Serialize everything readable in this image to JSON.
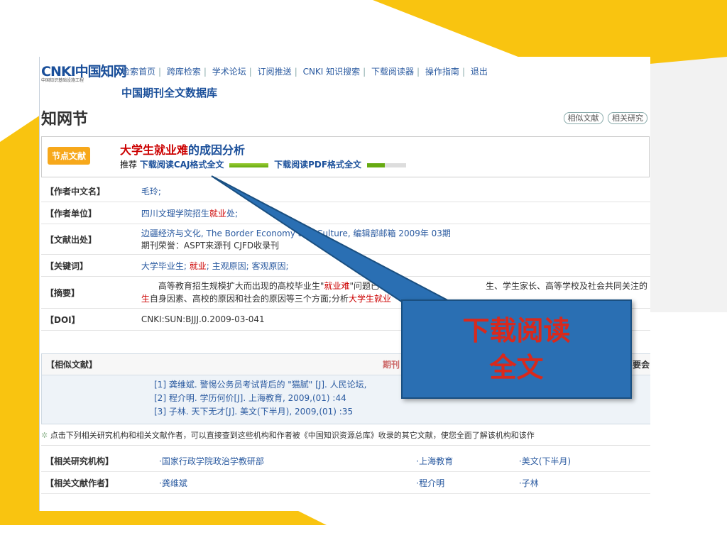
{
  "nav": {
    "logo": "CNKI中国知网",
    "logo_sub": "中国知识基础设施工程",
    "items": [
      "检索首页",
      "跨库检索",
      "学术论坛",
      "订阅推送",
      "CNKI 知识搜索",
      "下载阅读器",
      "操作指南",
      "退出"
    ]
  },
  "db_title": "中国期刊全文数据库",
  "zhijie": "知网节",
  "sim_buttons": [
    "相似文献",
    "相关研究"
  ],
  "article": {
    "badge": "节点文献",
    "title_a": "大学生",
    "title_b": "就业难",
    "title_c": "的成因分析",
    "recommend": "推荐",
    "caj": "下载阅读CAJ格式全文",
    "pdf": "下载阅读PDF格式全文"
  },
  "meta": {
    "author_label": "【作者中文名】",
    "author": "毛玲;",
    "unit_label": "【作者单位】",
    "unit_a": "四川文理学院招生",
    "unit_b": "就业",
    "unit_c": "处;",
    "source_label": "【文献出处】",
    "source": "边疆经济与文化, The Border Economy and Culture, 编辑部邮箱 2009年 03期",
    "source2": "期刊荣誉：ASPT来源刊 CJFD收录刊",
    "kw_label": "【关键词】",
    "kw_a": "大学毕业生; ",
    "kw_b": "就业",
    "kw_c": "; 主观原因; 客观原因;",
    "abs_label": "【摘要】",
    "abs_1": "高等教育招生规模扩大而出现的高校毕业生\"",
    "abs_2": "就业难",
    "abs_3": "\"问题已",
    "abs_4": "生、学生家长、高等学校及社会共同关注的",
    "abs_5": "生",
    "abs_6": "自身因素、高校的原因和社会的原因等三个方面;分析",
    "abs_7": "大学生就业",
    "doi_label": "【DOI】",
    "doi": "CNKI:SUN:BJJJ.0.2009-03-041"
  },
  "related": {
    "label": "【相似文献】",
    "k2": "期刊",
    "k3": "要会",
    "items": [
      "[1] 龚维斌. 警惕公务员考试背后的 \"猫腻\" [J]. 人民论坛,",
      "[2] 程介明. 学历何价[J]. 上海教育, 2009,(01) :44",
      "[3] 子林. 天下无才[J]. 美文(下半月), 2009,(01) :35"
    ]
  },
  "hint": "点击下列相关研究机构和相关文献作者，可以直接查到这些机构和作者被《中国知识资源总库》收录的其它文献，使您全面了解该机构和该作",
  "rel_table": {
    "org_label": "【相关研究机构】",
    "orgs": [
      "·国家行政学院政治学教研部",
      "·上海教育",
      "·美文(下半月)"
    ],
    "author_label": "【相关文献作者】",
    "authors": [
      "·龚维斌",
      "·程介明",
      "·子林"
    ]
  },
  "callout": {
    "line1": "下载阅读",
    "line2": "全文"
  },
  "colors": {
    "accent_yellow": "#f9c410",
    "callout_blue": "#2a6fb3",
    "callout_text": "#d9291c"
  }
}
